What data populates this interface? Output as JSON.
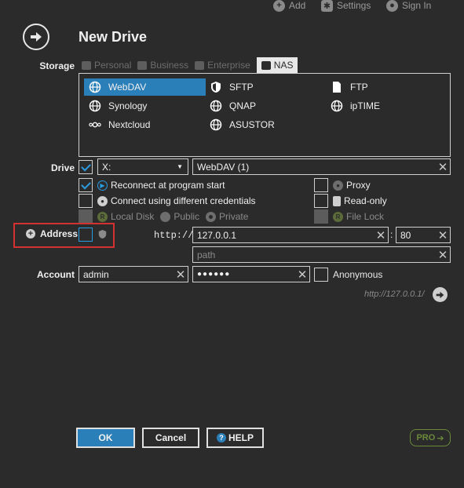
{
  "topbar": {
    "add_label": "Add",
    "settings_label": "Settings",
    "signin_label": "Sign In"
  },
  "header": {
    "title": "New Drive"
  },
  "storage": {
    "label": "Storage",
    "tabs": [
      {
        "label": "Personal",
        "icon": "person-icon"
      },
      {
        "label": "Business",
        "icon": "people-icon"
      },
      {
        "label": "Enterprise",
        "icon": "building-icon"
      },
      {
        "label": "NAS",
        "icon": "nas-icon",
        "active": true
      }
    ],
    "items": [
      {
        "label": "WebDAV",
        "icon": "globe-icon",
        "selected": true
      },
      {
        "label": "SFTP",
        "icon": "shield-icon"
      },
      {
        "label": "FTP",
        "icon": "file-icon"
      },
      {
        "label": "Synology",
        "icon": "globe-icon"
      },
      {
        "label": "QNAP",
        "icon": "globe-icon"
      },
      {
        "label": "ipTIME",
        "icon": "globe-icon"
      },
      {
        "label": "Nextcloud",
        "icon": "nextcloud-icon"
      },
      {
        "label": "ASUSTOR",
        "icon": "globe-icon"
      }
    ]
  },
  "drive": {
    "label": "Drive",
    "letter": "X:",
    "name": "WebDAV (1)"
  },
  "options": {
    "reconnect": "Reconnect at program start",
    "credentials": "Connect using different credentials",
    "local_disk": "Local Disk",
    "public": "Public",
    "private": "Private",
    "proxy": "Proxy",
    "readonly": "Read-only",
    "filelock": "File Lock"
  },
  "address": {
    "label": "Address",
    "scheme": "http://",
    "host": "127.0.0.1",
    "port": "80",
    "path_placeholder": "path"
  },
  "account": {
    "label": "Account",
    "user": "admin",
    "password": "●●●●●●",
    "anonymous": "Anonymous"
  },
  "preview_url": "http://127.0.0.1/",
  "buttons": {
    "ok": "OK",
    "cancel": "Cancel",
    "help": "HELP",
    "pro": "PRO"
  },
  "colors": {
    "accent": "#2b7fb8",
    "highlight_border": "#d43030",
    "pro_green": "#6b8a3a"
  }
}
